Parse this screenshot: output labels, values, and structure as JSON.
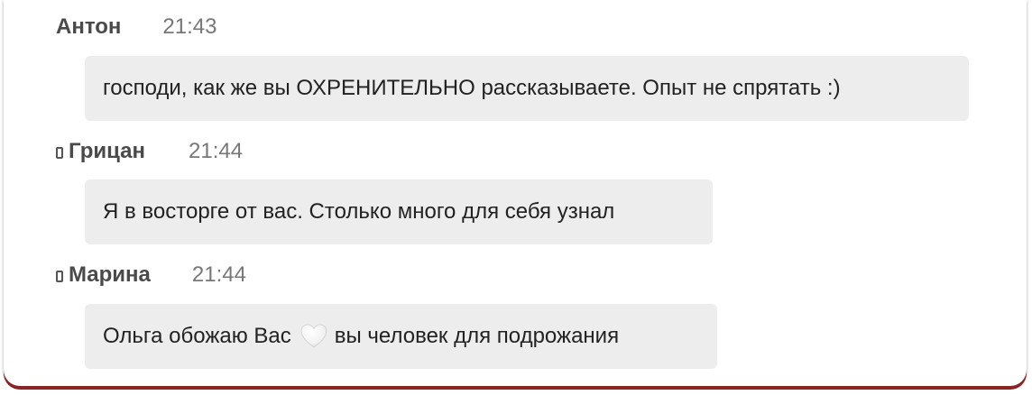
{
  "messages": [
    {
      "author": "Антон",
      "time": "21:43",
      "mobile": false,
      "text": "господи, как же вы ОХРЕНИТЕЛЬНО рассказываете. Опыт не спрятать :)"
    },
    {
      "author": "Грицан",
      "time": "21:44",
      "mobile": true,
      "text": "Я в восторге от вас. Столько много для себя узнал"
    },
    {
      "author": "Марина",
      "time": "21:44",
      "mobile": true,
      "text_before": "Ольга обожаю Вас",
      "icon": "white-heart-icon",
      "text_after": "вы человек для подрожания"
    }
  ],
  "colors": {
    "bubble": "#ededed",
    "author": "#4a4a4a",
    "time": "#777777",
    "frame_bottom": "#8a2424"
  }
}
